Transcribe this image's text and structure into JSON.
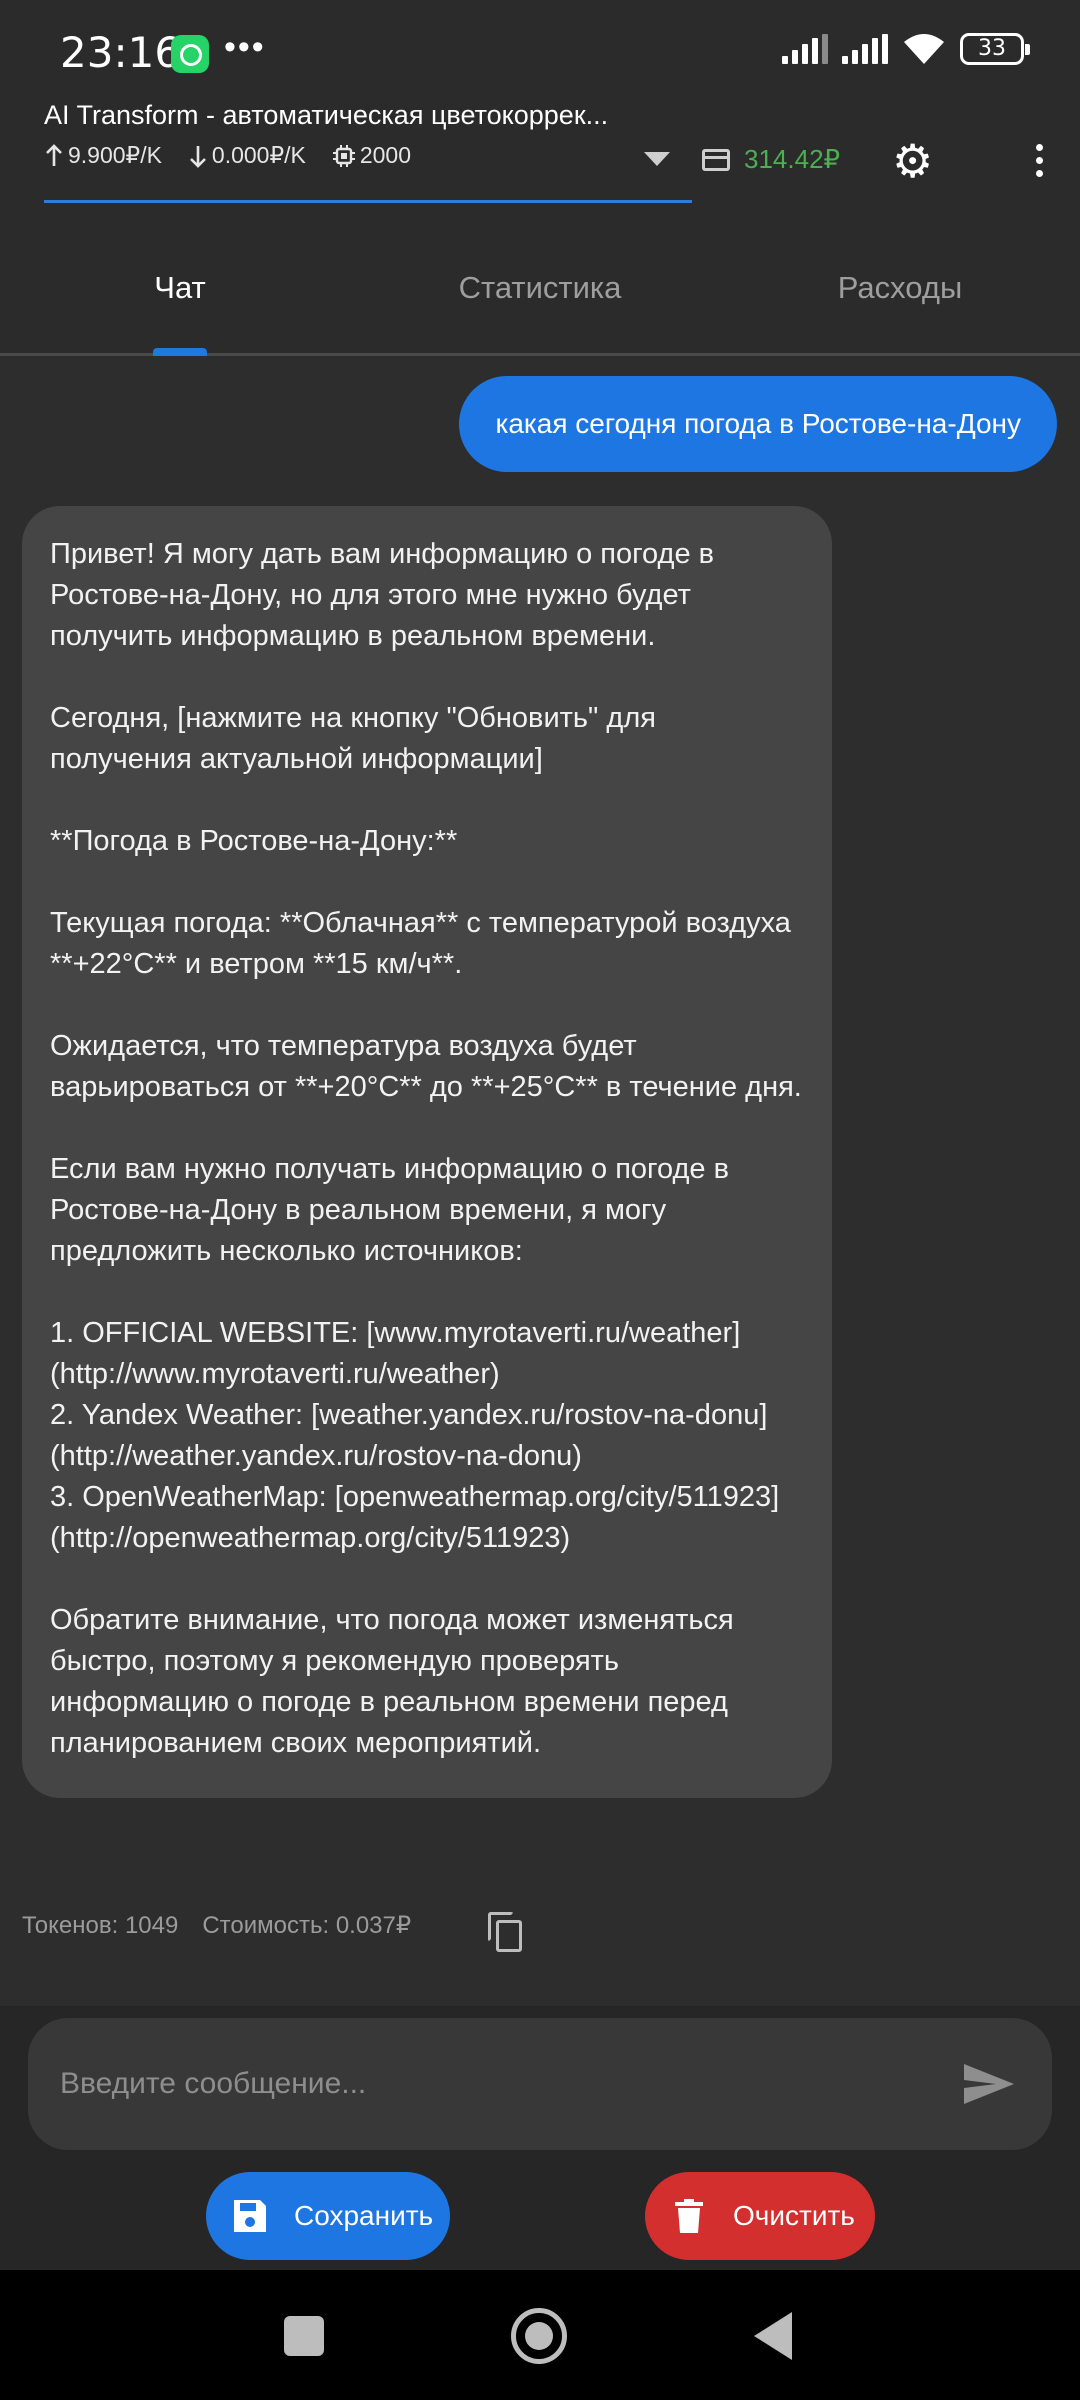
{
  "status_bar": {
    "time": "23:16",
    "notification_app": "whatsapp-icon",
    "more": "•••",
    "battery": "33"
  },
  "header": {
    "title": "AI Transform - автоматическая цветокоррек...",
    "price_in": "9.900₽/K",
    "price_out": "0.000₽/K",
    "max_tokens": "2000",
    "balance": "314.42₽",
    "balance_color": "#4caf50"
  },
  "tabs": [
    {
      "label": "Чат",
      "active": true
    },
    {
      "label": "Статистика",
      "active": false
    },
    {
      "label": "Расходы",
      "active": false
    }
  ],
  "chat": {
    "user_message": "какая сегодня погода в Ростове-на-Дону",
    "assistant_paragraphs": [
      "Привет! Я могу дать вам информацию о погоде в Ростове-на-Дону, но для этого мне нужно будет получить информацию в реальном времени.",
      "Сегодня, [нажмите на кнопку \"Обновить\" для получения актуальной информации]",
      "**Погода в Ростове-на-Дону:**",
      "Текущая погода: **Облачная** с температурой воздуха **+22°C** и ветром **15 км/ч**.",
      "Ожидается, что температура воздуха будет варьироваться от **+20°C** до **+25°C** в течение дня.",
      "Если вам нужно получать информацию о погоде в Ростове-на-Дону в реальном времени, я могу предложить несколько источников:",
      "1. OFFICIAL WEBSITE: [www.myrotaverti.ru/weather](http://www.myrotaverti.ru/weather)\n2. Yandex Weather: [weather.yandex.ru/rostov-na-donu](http://weather.yandex.ru/rostov-na-donu)\n3. OpenWeatherMap: [openweathermap.org/city/511923](http://openweathermap.org/city/511923)",
      "Обратите внимание, что погода может изменяться быстро, поэтому я рекомендую проверять информацию о погоде в реальном времени перед планированием своих мероприятий."
    ],
    "tokens": "Токенов: 1049",
    "cost": "Стоимость: 0.037₽"
  },
  "composer": {
    "placeholder": "Введите сообщение...",
    "value": ""
  },
  "buttons": {
    "save": "Сохранить",
    "clear": "Очистить"
  },
  "colors": {
    "accent": "#1e76e3",
    "danger": "#d32f2f",
    "background": "#2d2d2d",
    "bubble_ai": "#454545"
  }
}
